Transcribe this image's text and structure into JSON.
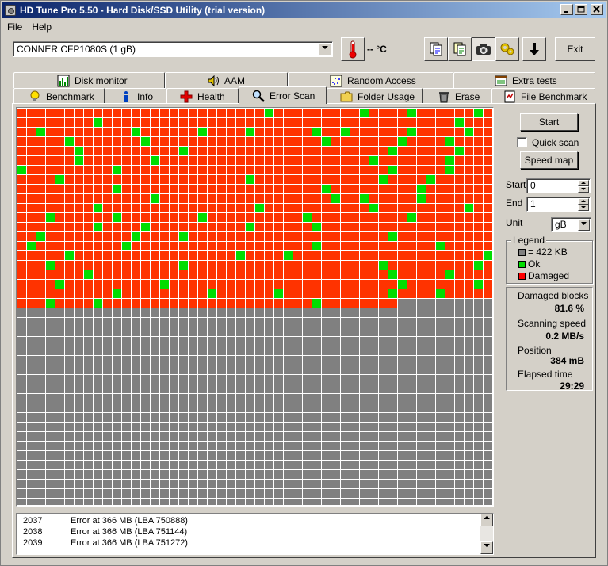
{
  "window": {
    "title": "HD Tune Pro 5.50 - Hard Disk/SSD Utility (trial version)"
  },
  "menu": {
    "file": "File",
    "help": "Help"
  },
  "toolbar": {
    "drive": "CONNER  CFP1080S (1 gB)",
    "temperature": "-- °C",
    "exit": "Exit"
  },
  "tabs": {
    "row1": [
      {
        "label": "Disk monitor",
        "icon": "disk-monitor-icon"
      },
      {
        "label": "AAM",
        "icon": "speaker-icon"
      },
      {
        "label": "Random Access",
        "icon": "random-access-icon"
      },
      {
        "label": "Extra tests",
        "icon": "extra-tests-icon"
      }
    ],
    "row2": [
      {
        "label": "Benchmark",
        "icon": "lightbulb-icon"
      },
      {
        "label": "Info",
        "icon": "info-icon"
      },
      {
        "label": "Health",
        "icon": "health-cross-icon"
      },
      {
        "label": "Error Scan",
        "icon": "magnifier-icon"
      },
      {
        "label": "Folder Usage",
        "icon": "folder-icon"
      },
      {
        "label": "Erase",
        "icon": "trash-icon"
      },
      {
        "label": "File Benchmark",
        "icon": "file-benchmark-icon"
      }
    ],
    "active": "Error Scan"
  },
  "scan": {
    "start_button": "Start",
    "quick_scan": "Quick scan",
    "quick_scan_checked": false,
    "speed_map_button": "Speed map",
    "start_label": "Start",
    "start_value": "0",
    "end_label": "End",
    "end_value": "1",
    "unit_label": "Unit",
    "unit_value": "gB"
  },
  "legend": {
    "title": "Legend",
    "block": "= 422 KB",
    "ok": "Ok",
    "damaged": "Damaged"
  },
  "stats": {
    "damaged_blocks_label": "Damaged blocks",
    "damaged_blocks_value": "81.6 %",
    "scanning_speed_label": "Scanning speed",
    "scanning_speed_value": "0.2 MB/s",
    "position_label": "Position",
    "position_value": "384 mB",
    "elapsed_label": "Elapsed time",
    "elapsed_value": "29:29"
  },
  "log": [
    {
      "num": "2037",
      "text": "Error at 366 MB (LBA 750888)"
    },
    {
      "num": "2038",
      "text": "Error at 366 MB (LBA 751144)"
    },
    {
      "num": "2039",
      "text": "Error at 366 MB (LBA 751272)"
    }
  ],
  "colors": {
    "damaged": "#ff3300",
    "ok": "#00dd00",
    "unscanned": "#808080",
    "grid_line": "#ffffff"
  },
  "grid": {
    "columns": 50,
    "rows": 42,
    "scanned_blocks": 1040,
    "ok_blocks": [
      [
        0,
        26
      ],
      [
        0,
        36
      ],
      [
        0,
        41
      ],
      [
        0,
        48
      ],
      [
        1,
        8
      ],
      [
        1,
        46
      ],
      [
        2,
        2
      ],
      [
        2,
        12
      ],
      [
        2,
        19
      ],
      [
        2,
        24
      ],
      [
        2,
        31
      ],
      [
        2,
        34
      ],
      [
        2,
        41
      ],
      [
        2,
        47
      ],
      [
        3,
        5
      ],
      [
        3,
        13
      ],
      [
        3,
        32
      ],
      [
        3,
        40
      ],
      [
        3,
        45
      ],
      [
        4,
        6
      ],
      [
        4,
        17
      ],
      [
        4,
        39
      ],
      [
        4,
        46
      ],
      [
        5,
        6
      ],
      [
        5,
        14
      ],
      [
        5,
        37
      ],
      [
        5,
        45
      ],
      [
        6,
        0
      ],
      [
        6,
        10
      ],
      [
        6,
        39
      ],
      [
        6,
        45
      ],
      [
        7,
        4
      ],
      [
        7,
        24
      ],
      [
        7,
        38
      ],
      [
        7,
        43
      ],
      [
        8,
        10
      ],
      [
        8,
        32
      ],
      [
        8,
        42
      ],
      [
        9,
        14
      ],
      [
        9,
        33
      ],
      [
        9,
        36
      ],
      [
        9,
        42
      ],
      [
        10,
        8
      ],
      [
        10,
        25
      ],
      [
        10,
        37
      ],
      [
        10,
        47
      ],
      [
        11,
        3
      ],
      [
        11,
        10
      ],
      [
        11,
        19
      ],
      [
        11,
        30
      ],
      [
        11,
        41
      ],
      [
        12,
        8
      ],
      [
        12,
        13
      ],
      [
        12,
        24
      ],
      [
        12,
        31
      ],
      [
        13,
        2
      ],
      [
        13,
        12
      ],
      [
        13,
        17
      ],
      [
        13,
        39
      ],
      [
        14,
        1
      ],
      [
        14,
        11
      ],
      [
        14,
        31
      ],
      [
        14,
        44
      ],
      [
        15,
        5
      ],
      [
        15,
        23
      ],
      [
        15,
        28
      ],
      [
        15,
        49
      ],
      [
        16,
        3
      ],
      [
        16,
        17
      ],
      [
        16,
        38
      ],
      [
        16,
        48
      ],
      [
        17,
        7
      ],
      [
        17,
        39
      ],
      [
        17,
        45
      ],
      [
        18,
        4
      ],
      [
        18,
        15
      ],
      [
        18,
        40
      ],
      [
        18,
        48
      ],
      [
        19,
        10
      ],
      [
        19,
        20
      ],
      [
        19,
        27
      ],
      [
        19,
        39
      ],
      [
        19,
        44
      ],
      [
        20,
        3
      ],
      [
        20,
        8
      ],
      [
        20,
        31
      ],
      [
        20,
        47
      ]
    ]
  }
}
